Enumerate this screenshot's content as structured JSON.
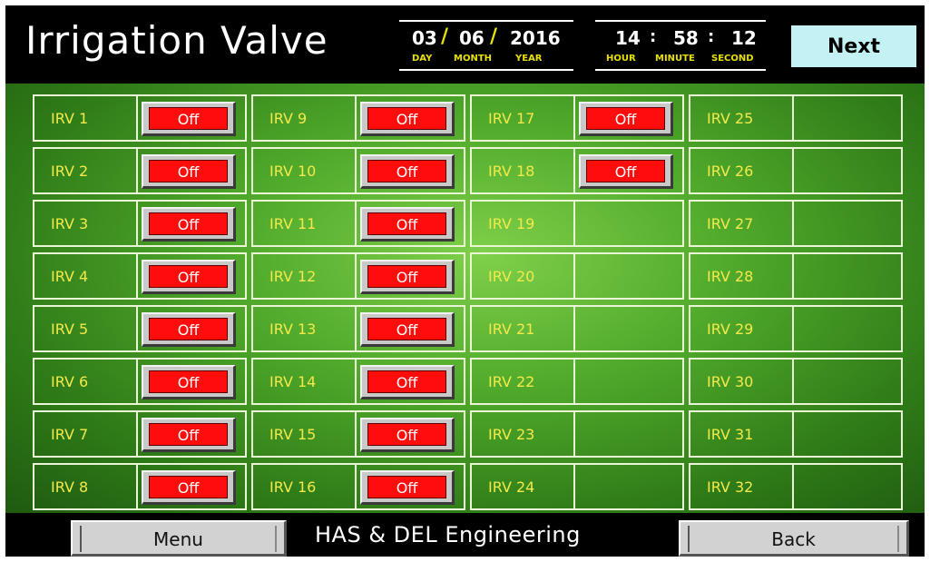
{
  "header": {
    "title": "Irrigation Valve",
    "date": {
      "day": "03",
      "month": "06",
      "year": "2016",
      "sep": "/",
      "day_label": "DAY",
      "month_label": "MONTH",
      "year_label": "YEAR"
    },
    "time": {
      "hour": "14",
      "minute": "58",
      "second": "12",
      "sep": ":",
      "hour_label": "HOUR",
      "minute_label": "MINUTE",
      "second_label": "SECOND"
    },
    "next_label": "Next"
  },
  "valves": [
    {
      "label": "IRV 1",
      "state": "Off"
    },
    {
      "label": "IRV 2",
      "state": "Off"
    },
    {
      "label": "IRV 3",
      "state": "Off"
    },
    {
      "label": "IRV 4",
      "state": "Off"
    },
    {
      "label": "IRV 5",
      "state": "Off"
    },
    {
      "label": "IRV 6",
      "state": "Off"
    },
    {
      "label": "IRV 7",
      "state": "Off"
    },
    {
      "label": "IRV 8",
      "state": "Off"
    },
    {
      "label": "IRV 9",
      "state": "Off"
    },
    {
      "label": "IRV 10",
      "state": "Off"
    },
    {
      "label": "IRV 11",
      "state": "Off"
    },
    {
      "label": "IRV 12",
      "state": "Off"
    },
    {
      "label": "IRV 13",
      "state": "Off"
    },
    {
      "label": "IRV 14",
      "state": "Off"
    },
    {
      "label": "IRV 15",
      "state": "Off"
    },
    {
      "label": "IRV 16",
      "state": "Off"
    },
    {
      "label": "IRV 17",
      "state": "Off"
    },
    {
      "label": "IRV 18",
      "state": "Off"
    },
    {
      "label": "IRV 19",
      "state": ""
    },
    {
      "label": "IRV 20",
      "state": ""
    },
    {
      "label": "IRV 21",
      "state": ""
    },
    {
      "label": "IRV 22",
      "state": ""
    },
    {
      "label": "IRV 23",
      "state": ""
    },
    {
      "label": "IRV 24",
      "state": ""
    },
    {
      "label": "IRV 25",
      "state": ""
    },
    {
      "label": "IRV 26",
      "state": ""
    },
    {
      "label": "IRV 27",
      "state": ""
    },
    {
      "label": "IRV 28",
      "state": ""
    },
    {
      "label": "IRV 29",
      "state": ""
    },
    {
      "label": "IRV 30",
      "state": ""
    },
    {
      "label": "IRV 31",
      "state": ""
    },
    {
      "label": "IRV 32",
      "state": ""
    }
  ],
  "footer": {
    "menu_label": "Menu",
    "company": "HAS & DEL Engineering",
    "back_label": "Back"
  },
  "colors": {
    "label_yellow": "#f4e94a",
    "valve_off_red": "#ff0d0d",
    "next_bg": "#c4f2f4"
  }
}
